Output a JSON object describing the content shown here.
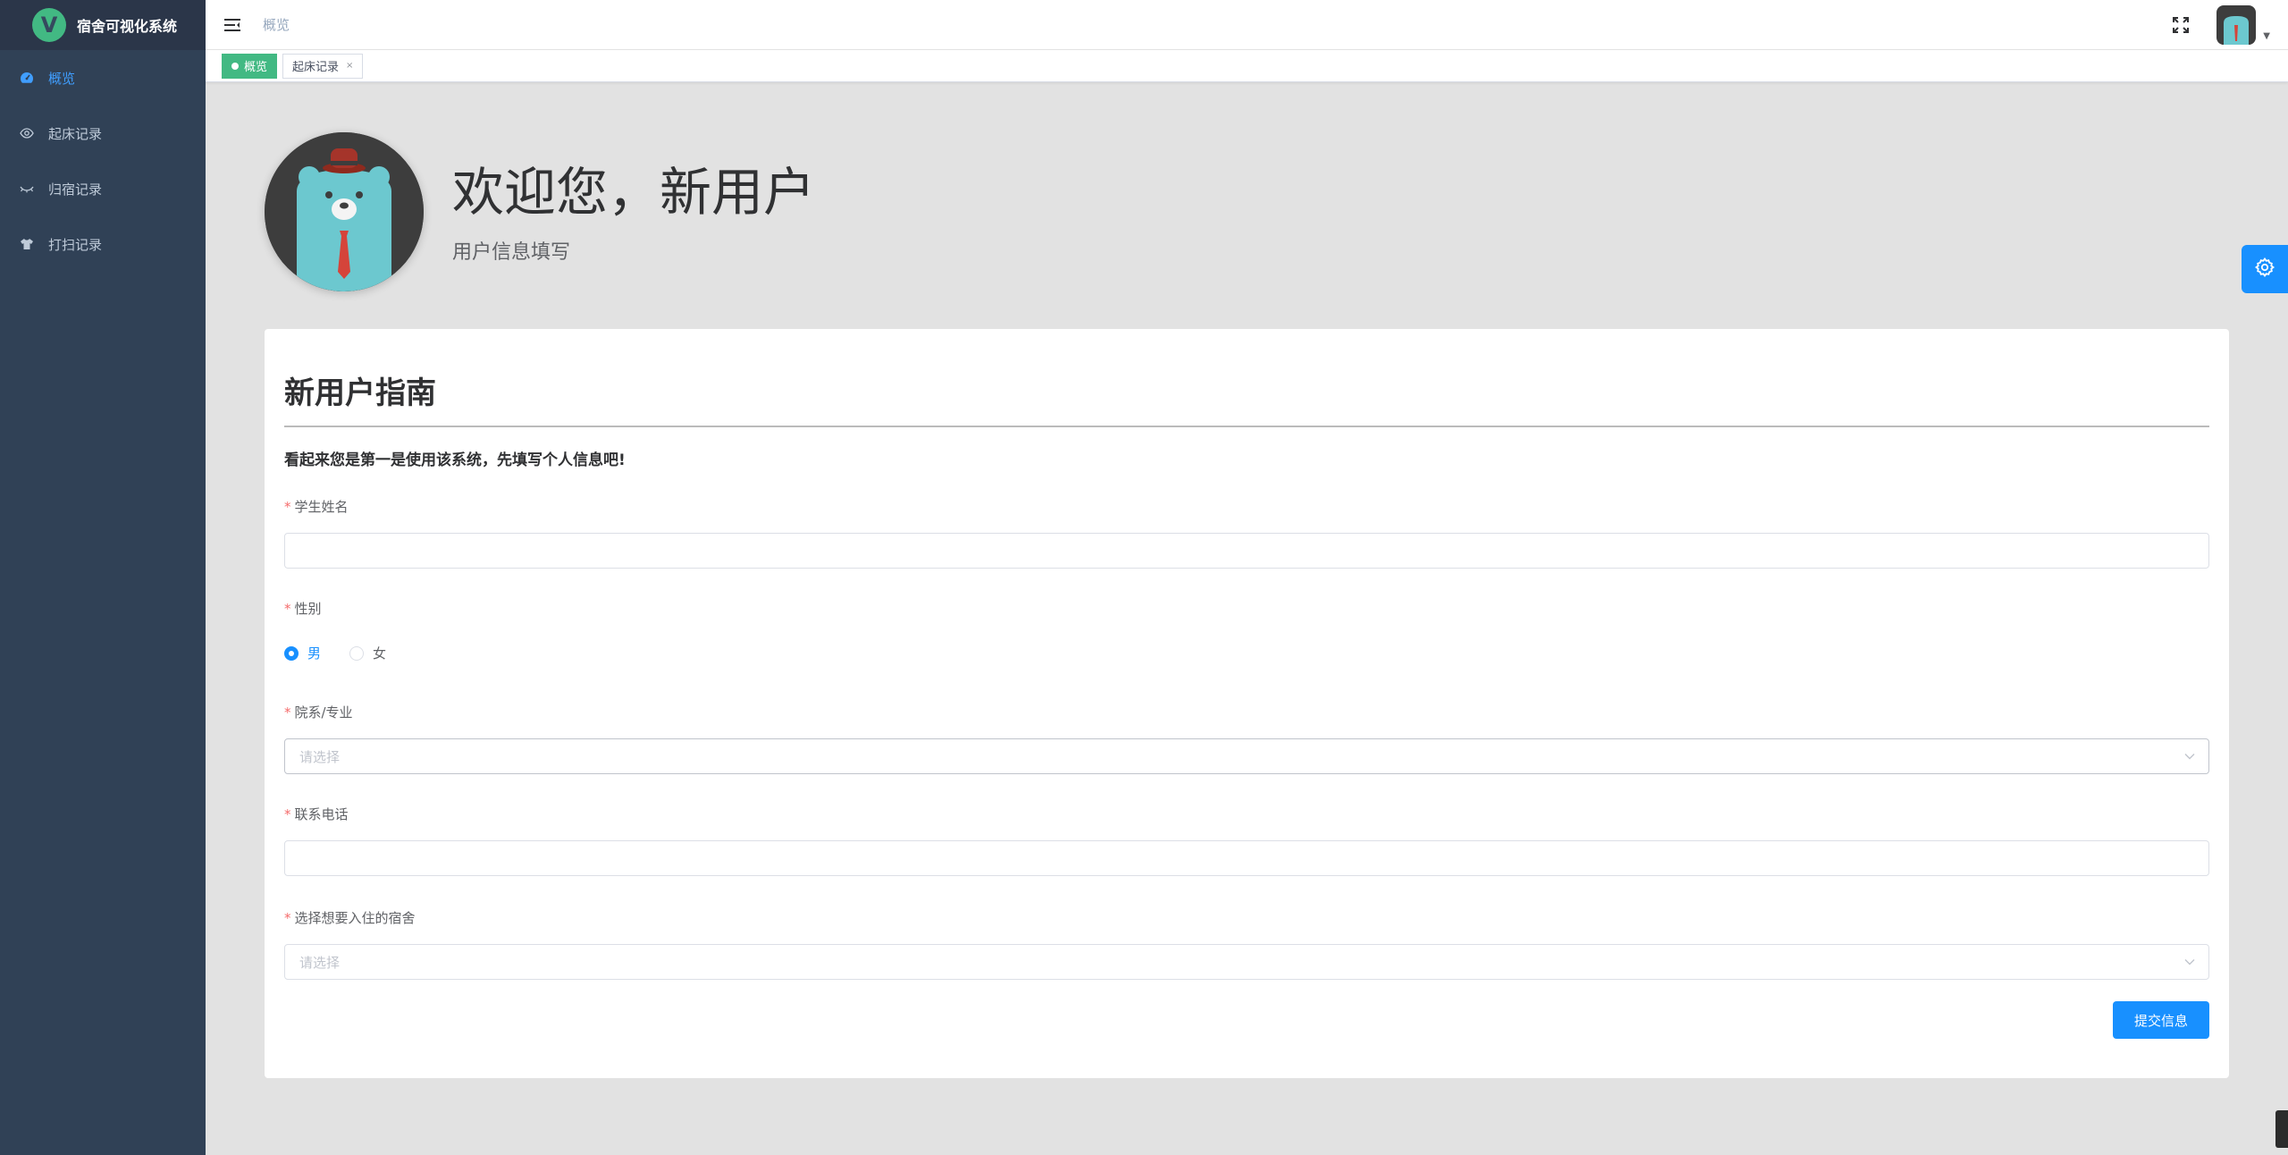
{
  "app": {
    "logo_letter": "V",
    "title": "宿舍可视化系统"
  },
  "sidebar": {
    "items": [
      {
        "label": "概览",
        "icon": "dashboard-icon",
        "active": true
      },
      {
        "label": "起床记录",
        "icon": "eye-icon",
        "active": false
      },
      {
        "label": "归宿记录",
        "icon": "eye-closed-icon",
        "active": false
      },
      {
        "label": "打扫记录",
        "icon": "shirt-icon",
        "active": false
      }
    ]
  },
  "navbar": {
    "breadcrumb": "概览"
  },
  "tags": [
    {
      "label": "概览",
      "active": true
    },
    {
      "label": "起床记录",
      "active": false,
      "close": "×"
    }
  ],
  "welcome": {
    "title": "欢迎您，新用户",
    "subtitle": "用户信息填写"
  },
  "card": {
    "title": "新用户指南",
    "intro": "看起来您是第一是使用该系统，先填写个人信息吧!",
    "fields": {
      "name": {
        "label": "学生姓名",
        "value": ""
      },
      "gender": {
        "label": "性别",
        "options": [
          "男",
          "女"
        ],
        "selected": "男"
      },
      "department": {
        "label": "院系/专业",
        "placeholder": "请选择"
      },
      "phone": {
        "label": "联系电话",
        "value": ""
      },
      "dorm": {
        "label": "选择想要入住的宿舍",
        "placeholder": "请选择"
      }
    },
    "submit_label": "提交信息"
  },
  "colors": {
    "sidebar_bg": "#304156",
    "accent": "#1890ff",
    "tag_active": "#42b983",
    "required": "#f56c6c"
  }
}
